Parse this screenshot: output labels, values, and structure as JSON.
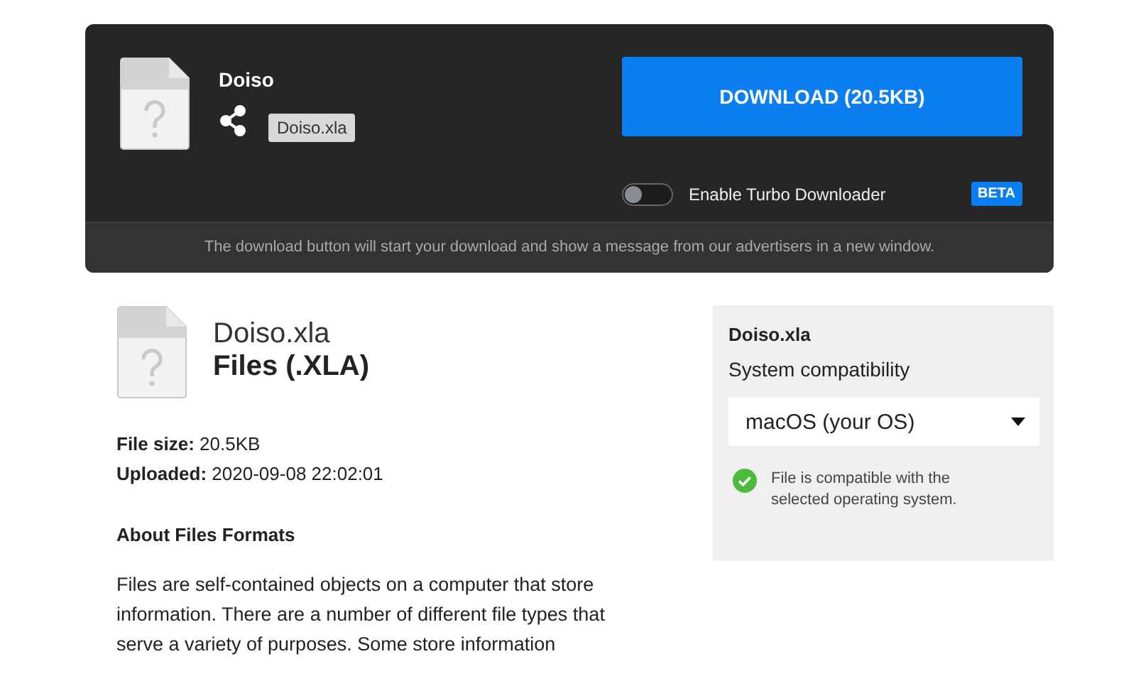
{
  "header": {
    "file_name": "Doiso",
    "tooltip": "Doiso.xla",
    "download_button": "DOWNLOAD (20.5KB)",
    "turbo": {
      "label": "Enable Turbo Downloader",
      "on": false,
      "badge": "BETA"
    },
    "notice": "The download button will start your download and show a message from our advertisers in a new window."
  },
  "file": {
    "name": "Doiso.xla",
    "type": "Files (.XLA)",
    "details": [
      {
        "label": "File size:",
        "value": "20.5KB"
      },
      {
        "label": "Uploaded:",
        "value": "2020-09-08 22:02:01"
      }
    ],
    "about_heading": "About Files Formats",
    "about_text": "Files are self-contained objects on a computer that store information. There are a number of different file types that serve a variety of purposes. Some store information"
  },
  "compat": {
    "title": "Doiso.xla",
    "label": "System compatibility",
    "select_value": "macOS (your OS)",
    "compatible": true,
    "message": "File is compatible with the selected operating system."
  }
}
